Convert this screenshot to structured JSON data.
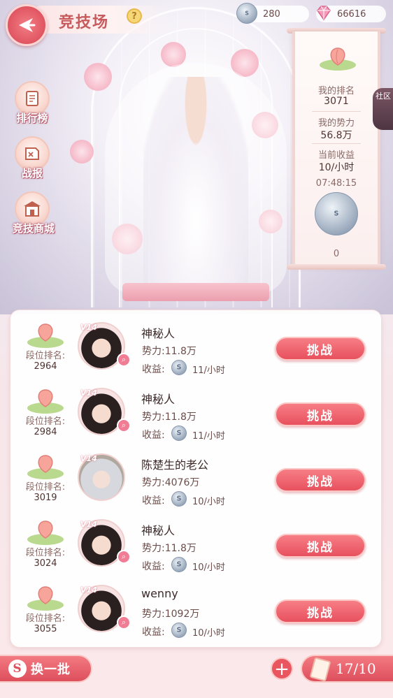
{
  "header": {
    "title": "竞技场",
    "help_icon": "?",
    "currencies": {
      "coins": "280",
      "gems": "66616"
    }
  },
  "side_menu": [
    {
      "label": "排行榜",
      "icon": "ranking-scroll-icon"
    },
    {
      "label": "战报",
      "icon": "battle-report-icon"
    },
    {
      "label": "竞技商城",
      "icon": "shop-gate-icon"
    }
  ],
  "my_stats": {
    "rank_label": "我的排名",
    "rank_value": "3071",
    "power_label": "我的势力",
    "power_value": "56.8万",
    "income_label": "当前收益",
    "income_value": "10/小时",
    "timer": "07:48:15",
    "accumulated": "0"
  },
  "community_tab": "社区",
  "opponents": [
    {
      "rank_label": "段位排名:",
      "rank": "2964",
      "vip": "V14",
      "name": "神秘人",
      "power": "势力:11.8万",
      "income_label": "收益:",
      "income": "11/小时",
      "button": "挑战"
    },
    {
      "rank_label": "段位排名:",
      "rank": "2984",
      "vip": "V14",
      "name": "神秘人",
      "power": "势力:11.8万",
      "income_label": "收益:",
      "income": "11/小时",
      "button": "挑战"
    },
    {
      "rank_label": "段位排名:",
      "rank": "3019",
      "vip": "V14",
      "name": "陈楚生的老公",
      "power": "势力:4076万",
      "income_label": "收益:",
      "income": "10/小时",
      "button": "挑战"
    },
    {
      "rank_label": "段位排名:",
      "rank": "3024",
      "vip": "V14",
      "name": "神秘人",
      "power": "势力:11.8万",
      "income_label": "收益:",
      "income": "10/小时",
      "button": "挑战"
    },
    {
      "rank_label": "段位排名:",
      "rank": "3055",
      "vip": "V14",
      "name": "wenny",
      "power": "势力:1092万",
      "income_label": "收益:",
      "income": "10/小时",
      "button": "挑战"
    }
  ],
  "footer": {
    "refresh_label": "换一批",
    "tickets": "17/10"
  },
  "colors": {
    "accent": "#e35b66",
    "panel_bg": "#ffffff",
    "title": "#c85a5c"
  }
}
